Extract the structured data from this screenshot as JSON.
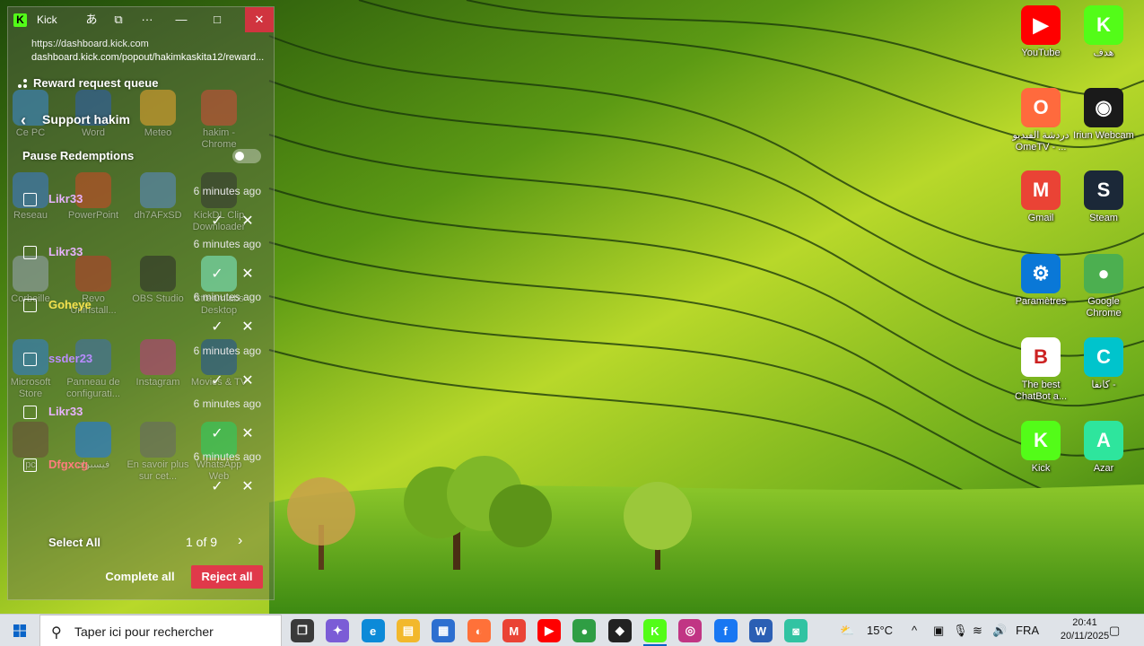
{
  "popout": {
    "tab_title": "Kick",
    "url_short": "https://dashboard.kick.com",
    "url_full": "dashboard.kick.com/popout/hakimkaskita12/reward...",
    "queue_title": "Reward request queue",
    "support_title": "Support hakim",
    "pause_label": "Pause Redemptions",
    "requests": [
      {
        "user": "Likr33",
        "time": "6 minutes ago",
        "color": "#e8b3ff"
      },
      {
        "user": "Likr33",
        "time": "6 minutes ago",
        "color": "#e8b3ff"
      },
      {
        "user": "Goheye",
        "time": "6 minutes ago",
        "color": "#f5e24f"
      },
      {
        "user": "ssder23",
        "time": "6 minutes ago",
        "color": "#b98cff"
      },
      {
        "user": "Likr33",
        "time": "6 minutes ago",
        "color": "#e8b3ff"
      },
      {
        "user": "Dfgxcg",
        "time": "6 minutes ago",
        "color": "#ff7d7d"
      }
    ],
    "select_all": "Select All",
    "pager": "1 of 9",
    "complete_all": "Complete all",
    "reject_all": "Reject all"
  },
  "ghost_icons": [
    {
      "label": "Ce PC",
      "color": "#3a8ad8"
    },
    {
      "label": "Word",
      "color": "#2b5fb4"
    },
    {
      "label": "Meteo",
      "color": "#f0a830"
    },
    {
      "label": "hakim - Chrome",
      "color": "#d64a3a"
    },
    {
      "label": "Reseau",
      "color": "#3a7bd5"
    },
    {
      "label": "PowerPoint",
      "color": "#d24726"
    },
    {
      "label": "dh7AFxSD",
      "color": "#5a8ccf"
    },
    {
      "label": "KickDL Clip Downloader",
      "color": "#333333"
    },
    {
      "label": "Corbeille",
      "color": "#9aa8b8"
    },
    {
      "label": "Revo Uninstall...",
      "color": "#c0392b"
    },
    {
      "label": "OBS Studio",
      "color": "#2a2a2a"
    },
    {
      "label": "Streamlabs Desktop",
      "color": "#80f5d2"
    },
    {
      "label": "Microsoft Store",
      "color": "#2d7fd8"
    },
    {
      "label": "Panneau de configurati...",
      "color": "#3d6fb6"
    },
    {
      "label": "Instagram",
      "color": "#c13584"
    },
    {
      "label": "Movies & TV",
      "color": "#1c4fa0"
    },
    {
      "label": "pc",
      "color": "#6a4a3a"
    },
    {
      "label": "فيسبوك",
      "color": "#1877f2"
    },
    {
      "label": "En savoir plus sur cet...",
      "color": "#666666"
    },
    {
      "label": "WhatsApp Web",
      "color": "#25d366"
    }
  ],
  "desktop_icons": [
    {
      "label": "YouTube",
      "glyph": "▶",
      "color": "#ff0000"
    },
    {
      "label": "هدف",
      "glyph": "K",
      "color": "#53fc18"
    },
    {
      "label": "دردشة الفيديو OmeTV - ...",
      "glyph": "O",
      "color": "#ff6a3d"
    },
    {
      "label": "Iriun Webcam",
      "glyph": "◉",
      "color": "#1a1a1a"
    },
    {
      "label": "Gmail",
      "glyph": "M",
      "color": "#ea4335"
    },
    {
      "label": "Steam",
      "glyph": "S",
      "color": "#1b2838"
    },
    {
      "label": "Paramètres",
      "glyph": "⚙",
      "color": "#0a78d7"
    },
    {
      "label": "Google Chrome",
      "glyph": "●",
      "color": "#4caf50"
    },
    {
      "label": "The best ChatBot a...",
      "glyph": "B",
      "color": "#ffffff"
    },
    {
      "label": "كانفا -",
      "glyph": "C",
      "color": "#00c4cc"
    },
    {
      "label": "Kick",
      "glyph": "K",
      "color": "#53fc18"
    },
    {
      "label": "Azar",
      "glyph": "A",
      "color": "#2ee59d"
    }
  ],
  "taskbar": {
    "search_placeholder": "Taper ici pour rechercher",
    "apps": [
      {
        "name": "task-view",
        "glyph": "❐",
        "color": "#3a3a3a"
      },
      {
        "name": "copilot",
        "glyph": "✦",
        "color": "#7b5cd6"
      },
      {
        "name": "edge",
        "glyph": "e",
        "color": "#0c8ad8"
      },
      {
        "name": "file-explorer",
        "glyph": "▤",
        "color": "#f2b82c"
      },
      {
        "name": "store",
        "glyph": "▦",
        "color": "#2d6fd0"
      },
      {
        "name": "firefox",
        "glyph": "◐",
        "color": "#ff7139"
      },
      {
        "name": "gmail",
        "glyph": "M",
        "color": "#ea4335"
      },
      {
        "name": "youtube",
        "glyph": "▶",
        "color": "#ff0000"
      },
      {
        "name": "chrome-hakim",
        "glyph": "●",
        "color": "#2f9e44"
      },
      {
        "name": "capcut",
        "glyph": "◆",
        "color": "#222222"
      },
      {
        "name": "kick",
        "glyph": "K",
        "color": "#53fc18"
      },
      {
        "name": "instagram",
        "glyph": "◎",
        "color": "#c13584"
      },
      {
        "name": "facebook",
        "glyph": "f",
        "color": "#1877f2"
      },
      {
        "name": "word",
        "glyph": "W",
        "color": "#2b5fb4"
      },
      {
        "name": "streamlabs",
        "glyph": "◙",
        "color": "#31c3a2"
      }
    ],
    "weather": "15°C",
    "language": "FRA",
    "time": "20:41",
    "date": "20/11/2025"
  }
}
